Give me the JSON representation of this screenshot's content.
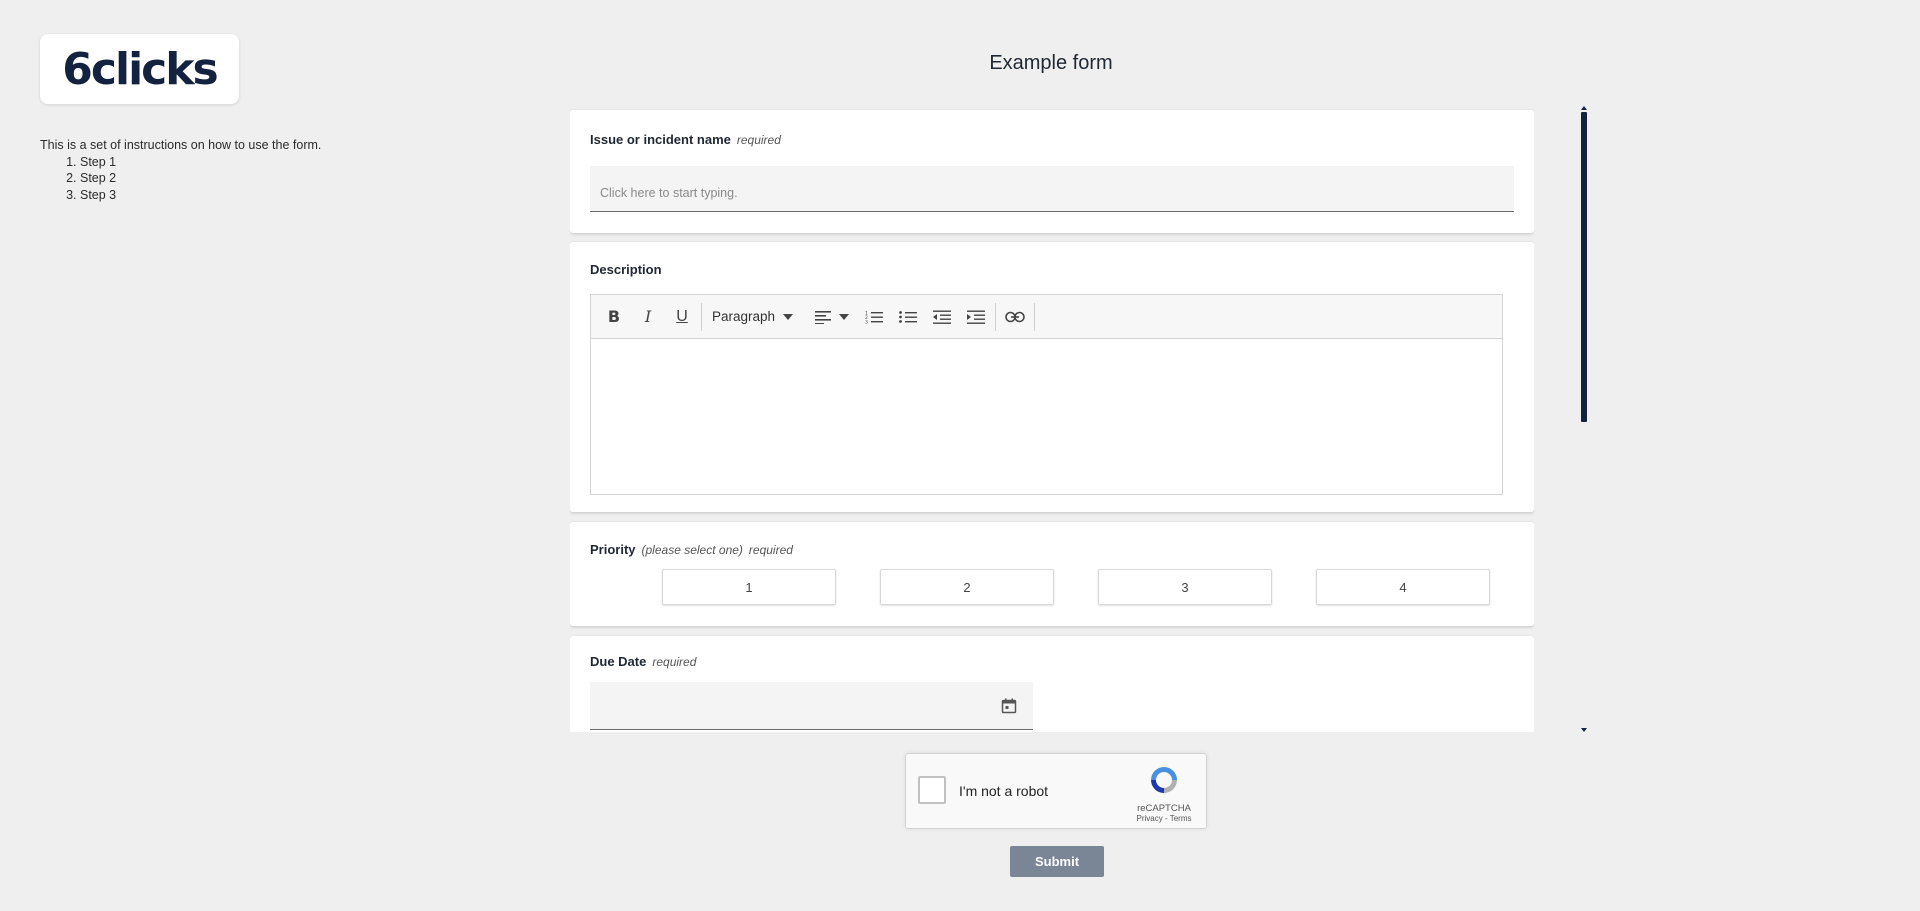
{
  "logo": {
    "text": "6clicks"
  },
  "instructions": {
    "intro": "This is a set of instructions on how to use the form.",
    "steps": [
      "Step 1",
      "Step 2",
      "Step 3"
    ]
  },
  "form": {
    "title": "Example form",
    "issue_name": {
      "label": "Issue or incident name",
      "required": "required",
      "placeholder": "Click here to start typing."
    },
    "description": {
      "label": "Description",
      "toolbar": {
        "paragraph_label": "Paragraph",
        "icons": [
          "bold-icon",
          "italic-icon",
          "underline-icon",
          "align-icon",
          "numbered-list-icon",
          "bullet-list-icon",
          "outdent-icon",
          "indent-icon",
          "link-icon"
        ]
      }
    },
    "priority": {
      "label": "Priority",
      "hint": "(please select one)",
      "required": "required",
      "options": [
        "1",
        "2",
        "3",
        "4"
      ]
    },
    "due_date": {
      "label": "Due Date",
      "required": "required"
    }
  },
  "captcha": {
    "label": "I'm not a robot",
    "brand": "reCAPTCHA",
    "links": "Privacy - Terms"
  },
  "submit_label": "Submit",
  "colors": {
    "brand": "#13233f",
    "submit": "#7a8596",
    "background": "#efefef"
  }
}
